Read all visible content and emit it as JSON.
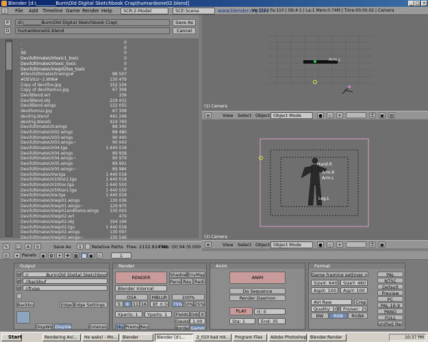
{
  "window": {
    "title": "Blender [d:\\________Burn\\Old Digital Sketchbook Crap\\humanbone02.blend]",
    "btn_min": "_",
    "btn_max": "□",
    "btn_close": "×"
  },
  "menubar": {
    "items": [
      "File",
      "Add",
      "Timeline",
      "Game",
      "Render",
      "Help"
    ],
    "screen": "SCR:2-Model",
    "scene": "SCE:Scene",
    "site": "www.blender.org 234",
    "stats": "Ve:112 | Fa:110 | Ob:4-1 | La:1  Mem:0.74M | Time:00:00.02 | Camera"
  },
  "filebrowser": {
    "path": "d:\\________Burn\\Old Digital Sketchbook Crap\\",
    "filename": "humanbone02.blend",
    "save_label": "Save As",
    "cancel_label": "Cancel",
    "p_label": "P",
    "d_label": "D",
    "files": [
      {
        "name": ".",
        "size": "0",
        "dir": true
      },
      {
        "name": "..",
        "size": "0",
        "dir": true
      },
      {
        "name": "3d",
        "size": "0",
        "dir": true
      },
      {
        "name": "DevilUltimateUVtoxic1_toxic",
        "size": "0",
        "dir": true
      },
      {
        "name": "DevilUltimateUVtoxic_toxic",
        "size": "0",
        "dir": true
      },
      {
        "name": "DevilUltimateUVwip02tox_toxic",
        "size": "0",
        "dir": true
      },
      {
        "name": "#DevilUltimateUV.wings#",
        "size": "88 507",
        "dir": false
      },
      {
        "name": "#DEVILU~2.WIN#",
        "size": "130 479",
        "dir": false
      },
      {
        "name": "Copy of devilfuv.jpg",
        "size": "152 104",
        "dir": false
      },
      {
        "name": "Copy of devilhomuv.jpg",
        "size": "67 308",
        "dir": false
      },
      {
        "name": "DevilBlend.wrl",
        "size": "336",
        "dir": false
      },
      {
        "name": "DevilBlend.obj",
        "size": "229 431",
        "dir": false
      },
      {
        "name": "DevilBlend.wings",
        "size": "122 055",
        "dir": false
      },
      {
        "name": "devilhomuv.jpg",
        "size": "67 308",
        "dir": false
      },
      {
        "name": "devilrig.blend",
        "size": "441 248",
        "dir": false
      },
      {
        "name": "devilrig.blend1",
        "size": "424 760",
        "dir": false
      },
      {
        "name": "DevilUltimateUV.wings",
        "size": "88 340",
        "dir": false
      },
      {
        "name": "DevilUltimateUV02.wings",
        "size": "88 480",
        "dir": false
      },
      {
        "name": "DevilUltimateUV03.wings",
        "size": "90 440",
        "dir": false
      },
      {
        "name": "DevilUltimateUV03.wings~",
        "size": "90 043",
        "dir": false
      },
      {
        "name": "DevilUltimateUV04.tga",
        "size": "1 440 018",
        "dir": false
      },
      {
        "name": "DevilUltimateUV04.wings",
        "size": "89 958",
        "dir": false
      },
      {
        "name": "DevilUltimateUV04.wings~",
        "size": "90 979",
        "dir": false
      },
      {
        "name": "DevilUltimateUV05.wings",
        "size": "89 991",
        "dir": false
      },
      {
        "name": "DevilUltimateUV05.wings~",
        "size": "89 984",
        "dir": false
      },
      {
        "name": "DevilUltimateUVw.tga",
        "size": "1 440 018",
        "dir": false
      },
      {
        "name": "DevilUltimateUV10tox1.tga",
        "size": "1 440 018",
        "dir": false
      },
      {
        "name": "DevilUltimateUV10tox.tga",
        "size": "1 440 550",
        "dir": false
      },
      {
        "name": "DevilUltimateUV50tox1.tga",
        "size": "1 440 550",
        "dir": false
      },
      {
        "name": "DevilUltimateUVw.tga",
        "size": "1 440 018",
        "dir": false
      },
      {
        "name": "DevilUltimateUVwip01.wings",
        "size": "130 036",
        "dir": false
      },
      {
        "name": "DevilUltimateUVwip01.wings~",
        "size": "129 975",
        "dir": false
      },
      {
        "name": "DevilUltimateUVwip01andhoms.wings",
        "size": "130 043",
        "dir": false
      },
      {
        "name": "DevilUltimateUVwip02.wrl",
        "size": "470",
        "dir": false
      },
      {
        "name": "DevilUltimateUVwip02.obj",
        "size": "194 194",
        "dir": false
      },
      {
        "name": "DevilUltimateUVwip02.tga",
        "size": "1 440 018",
        "dir": false
      },
      {
        "name": "DevilUltimateUVwip02.wings",
        "size": "130 097",
        "dir": false
      },
      {
        "name": "DevilUltimateUVwip02.wings~",
        "size": "130 546",
        "dir": false
      }
    ],
    "free": "Free: 2122.824 Mb",
    "files_count": "Files: (0) 94",
    "zero": "(0.000"
  },
  "viewport_top": {
    "camera_label": "(1) Camera",
    "bones": [
      "Arm.L",
      "Leg.L"
    ]
  },
  "viewport_bottom": {
    "camera_label": "(1) Camera",
    "bones": [
      "Hand.R",
      "Arm.R",
      "Leg.R",
      "Torso",
      "Neck",
      "Head.L",
      "Leg.L",
      "Hand.L",
      "Arm.L"
    ]
  },
  "view_header": {
    "view": "View",
    "select": "Select",
    "object": "Object",
    "mode": "Object Mode"
  },
  "buttons_header": {
    "panels": "Panels",
    "frame": "1"
  },
  "output": {
    "title": "Output",
    "path1": "//________Burn\\Old Digital Sketchbook Crap\\",
    "path2": "//backbuf",
    "path3": "//ftype",
    "backbuf": "Backbuf",
    "edge": "Edge",
    "edge_settings": "Edge Settings >>",
    "dispwin": "DispWin",
    "dispview": "DispView",
    "extensions": "Extensio"
  },
  "render": {
    "title": "Render",
    "render_btn": "RENDER",
    "shadow": "Shadow",
    "envmap": "EnvMap",
    "pano": "Pano",
    "ray": "Ray",
    "radio": "Radi",
    "renderer": "Blender Internal",
    "osa": "OSA",
    "mblur": "MBLUR",
    "osa_vals": [
      "5",
      "8",
      "11",
      "16"
    ],
    "bf": "Bf: 0.50",
    "percent": "100%",
    "p75": "75%",
    "p50": "50%",
    "p25": "25%",
    "xparts": "Xparts: 1",
    "yparts": "Yparts: 1",
    "fields": "Fields",
    "odd": "Odd",
    "x": "X",
    "gauss": "Gauss",
    "gauss_val": "1.00",
    "sky": "Sky",
    "premul": "Premul",
    "key": "Key",
    "border": "Border",
    "gamma": "Gamma"
  },
  "anim": {
    "title": "Anim",
    "anim_btn": "ANIM",
    "do_sequence": "Do Sequence",
    "render_daemon": "Render Daemon",
    "play": "PLAY",
    "rt": "rt: 0",
    "sta": "Sta: 1",
    "end": "End: 35"
  },
  "format": {
    "title": "Format",
    "game_settings": "Game framing settings >>",
    "sizex": "SizeX: 640",
    "sizey": "SizeY: 480",
    "aspx": "AspX: 100",
    "aspy": "AspY: 100",
    "codec": "AVI Raw",
    "crop": "Crop",
    "quality": "Quality: 100",
    "fps": "Frs/sec: 25",
    "bw": "BW",
    "rgb": "RGB",
    "rgba": "RGBA",
    "presets": [
      "PAL",
      "NTSC",
      "Default",
      "Preview",
      "PC",
      "PAL 16:9",
      "PANO",
      "FULL",
      "Unified Rend"
    ]
  },
  "taskbar": {
    "start": "Start",
    "tasks": [
      "Rendering Ani...",
      "He waks! - Mo...",
      "Blender",
      "Blender [d:\\...",
      "2_010 bad mk...",
      "Program Files",
      "Adobe Photoshop",
      "Blender:Render"
    ],
    "clock": "10:37 PM"
  }
}
